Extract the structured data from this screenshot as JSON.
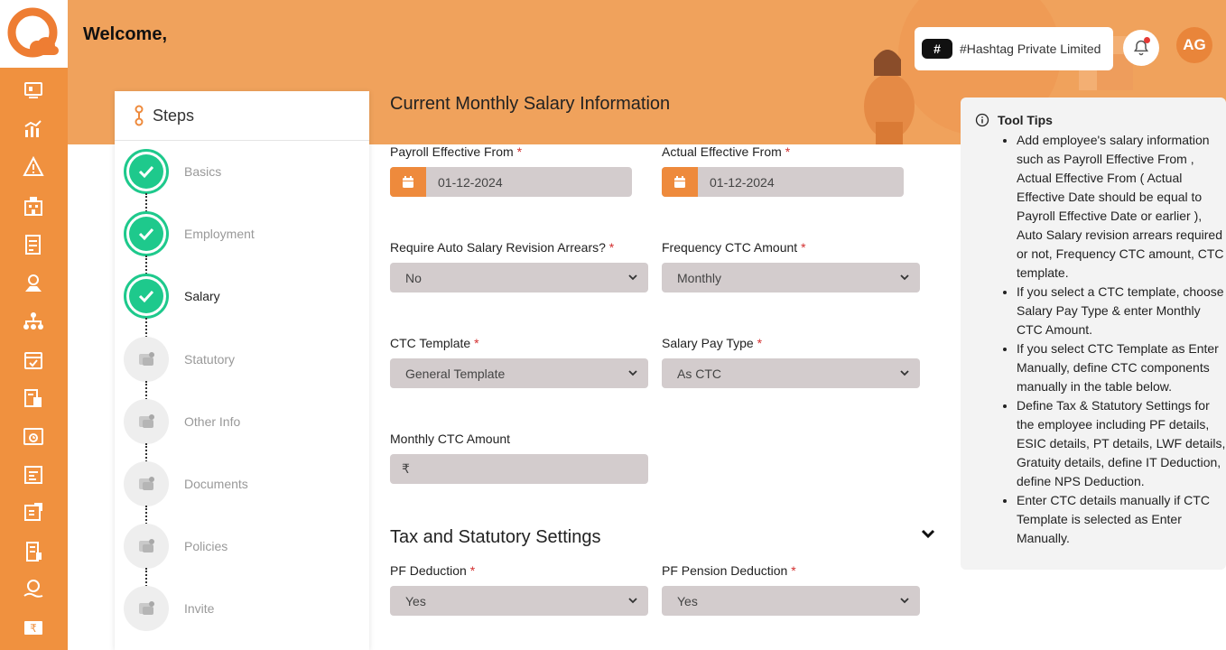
{
  "header": {
    "welcome": "Welcome,",
    "company_badge": "#",
    "company_name": "#Hashtag Private Limited",
    "avatar_initials": "AG"
  },
  "sidebar": {
    "icons": [
      "dashboard-icon",
      "analytics-icon",
      "alert-icon",
      "building-icon",
      "tax-icon",
      "award-icon",
      "org-chart-icon",
      "calendar-check-icon",
      "payslip-icon",
      "attendance-clock-icon",
      "reports-icon",
      "expense-icon",
      "documents-icon",
      "benefits-icon",
      "payroll-rupee-icon"
    ]
  },
  "steps": {
    "title": "Steps",
    "items": [
      {
        "label": "Basics",
        "status": "done"
      },
      {
        "label": "Employment",
        "status": "done"
      },
      {
        "label": "Salary",
        "status": "current"
      },
      {
        "label": "Statutory",
        "status": "todo"
      },
      {
        "label": "Other Info",
        "status": "todo"
      },
      {
        "label": "Documents",
        "status": "todo"
      },
      {
        "label": "Policies",
        "status": "todo"
      },
      {
        "label": "Invite",
        "status": "todo"
      }
    ]
  },
  "form": {
    "title": "Current Monthly Salary Information",
    "payroll_effective_from": {
      "label": "Payroll Effective From",
      "value": "01-12-2024"
    },
    "actual_effective_from": {
      "label": "Actual Effective From",
      "value": "01-12-2024"
    },
    "auto_arrears": {
      "label": "Require Auto Salary Revision Arrears?",
      "value": "No"
    },
    "frequency_ctc": {
      "label": "Frequency CTC Amount",
      "value": "Monthly"
    },
    "ctc_template": {
      "label": "CTC Template",
      "value": "General Template"
    },
    "salary_pay_type": {
      "label": "Salary Pay Type",
      "value": "As CTC"
    },
    "monthly_ctc": {
      "label": "Monthly CTC Amount",
      "value": "₹"
    },
    "tax_section_title": "Tax and Statutory Settings",
    "pf_deduction": {
      "label": "PF Deduction",
      "value": "Yes"
    },
    "pf_pension": {
      "label": "PF Pension Deduction",
      "value": "Yes"
    },
    "required_mark": "*"
  },
  "tooltips": {
    "title": "Tool Tips",
    "items": [
      "Add employee's salary information such as Payroll Effective From , Actual Effective From ( Actual Effective Date should be equal to Payroll Effective Date or earlier ), Auto Salary revision arrears required or not, Frequency CTC amount, CTC template.",
      "If you select a CTC template, choose Salary Pay Type & enter Monthly CTC Amount.",
      "If you select CTC Template as Enter Manually, define CTC components manually in the table below.",
      "Define Tax & Statutory Settings for the employee including PF details, ESIC details, PT details, LWF details, Gratuity details, define IT Deduction, define NPS Deduction.",
      "Enter CTC details manually if CTC Template is selected as Enter Manually."
    ]
  },
  "colors": {
    "sidebar": "#f0913f",
    "header": "#f0a25c",
    "accent": "#ee8a3c",
    "success": "#1ec98c",
    "input_bg": "#d3cccd"
  }
}
